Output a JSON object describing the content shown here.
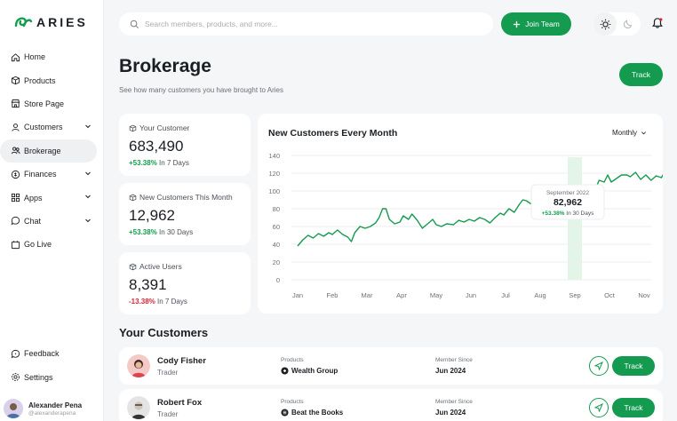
{
  "brand": {
    "name": "ARIES",
    "accent": "#149b50"
  },
  "sidebar": {
    "items": [
      {
        "label": "Home",
        "icon": "home-icon"
      },
      {
        "label": "Products",
        "icon": "box-icon"
      },
      {
        "label": "Store Page",
        "icon": "store-icon"
      },
      {
        "label": "Customers",
        "icon": "user-icon",
        "has_submenu": true
      },
      {
        "label": "Brokerage",
        "icon": "users-icon",
        "active": true
      },
      {
        "label": "Finances",
        "icon": "finance-icon",
        "has_submenu": true
      },
      {
        "label": "Apps",
        "icon": "grid-icon",
        "has_submenu": true
      },
      {
        "label": "Chat",
        "icon": "chat-icon",
        "has_submenu": true
      },
      {
        "label": "Go Live",
        "icon": "calendar-icon"
      }
    ],
    "bottom": [
      {
        "label": "Feedback",
        "icon": "feedback-icon"
      },
      {
        "label": "Settings",
        "icon": "gear-icon"
      }
    ],
    "user": {
      "name": "Alexander Pena",
      "handle": "@alexanderapena"
    }
  },
  "topbar": {
    "search_placeholder": "Search members, products, and more...",
    "join_label": "Join Team"
  },
  "header": {
    "title": "Brokerage",
    "subtitle": "See how many customers you have brought to Aries",
    "track_label": "Track"
  },
  "stats": [
    {
      "label": "Your Customer",
      "value": "683,490",
      "change": "+53.38%",
      "period": "In 7 Days",
      "trend": "up"
    },
    {
      "label": "New Customers This Month",
      "value": "12,962",
      "change": "+53.38%",
      "period": "In 30 Days",
      "trend": "up"
    },
    {
      "label": "Active Users",
      "value": "8,391",
      "change": "-13.38%",
      "period": "In 7 Days",
      "trend": "down"
    }
  ],
  "chart": {
    "title": "New Customers Every Month",
    "period_label": "Monthly",
    "tooltip": {
      "date": "September 2022",
      "value": "82,962",
      "change": "+53.38%",
      "period": "In 30 Days"
    }
  },
  "chart_data": {
    "type": "line",
    "title": "New Customers Every Month",
    "categories": [
      "Jan",
      "Feb",
      "Mar",
      "Apr",
      "May",
      "Jun",
      "Jul",
      "Aug",
      "Sep",
      "Oct",
      "Nov"
    ],
    "y_ticks": [
      0,
      20,
      40,
      60,
      80,
      100,
      120,
      140
    ],
    "ylim": [
      0,
      140
    ],
    "grid": true,
    "highlight_category": "Sep",
    "series": [
      {
        "color": "#149b50",
        "points": [
          [
            0,
            38
          ],
          [
            0.15,
            45
          ],
          [
            0.3,
            50
          ],
          [
            0.45,
            47
          ],
          [
            0.6,
            52
          ],
          [
            0.75,
            49
          ],
          [
            0.9,
            53
          ],
          [
            1.0,
            51
          ],
          [
            1.15,
            56
          ],
          [
            1.3,
            51
          ],
          [
            1.45,
            48
          ],
          [
            1.55,
            43
          ],
          [
            1.65,
            53
          ],
          [
            1.8,
            60
          ],
          [
            1.95,
            58
          ],
          [
            2.1,
            60
          ],
          [
            2.25,
            64
          ],
          [
            2.35,
            70
          ],
          [
            2.45,
            80
          ],
          [
            2.55,
            80
          ],
          [
            2.65,
            68
          ],
          [
            2.8,
            63
          ],
          [
            2.95,
            65
          ],
          [
            3.05,
            72
          ],
          [
            3.2,
            68
          ],
          [
            3.3,
            74
          ],
          [
            3.45,
            67
          ],
          [
            3.6,
            58
          ],
          [
            3.75,
            63
          ],
          [
            3.9,
            68
          ],
          [
            4.0,
            62
          ],
          [
            4.15,
            60
          ],
          [
            4.3,
            63
          ],
          [
            4.5,
            62
          ],
          [
            4.65,
            67
          ],
          [
            4.8,
            65
          ],
          [
            4.95,
            68
          ],
          [
            5.1,
            66
          ],
          [
            5.25,
            70
          ],
          [
            5.4,
            68
          ],
          [
            5.55,
            64
          ],
          [
            5.7,
            70
          ],
          [
            5.85,
            75
          ],
          [
            5.95,
            73
          ],
          [
            6.1,
            80
          ],
          [
            6.25,
            76
          ],
          [
            6.4,
            85
          ],
          [
            6.5,
            90
          ],
          [
            6.6,
            89
          ],
          [
            6.75,
            85
          ],
          [
            6.9,
            88
          ],
          [
            7.05,
            83
          ],
          [
            7.2,
            90
          ],
          [
            7.35,
            86
          ],
          [
            7.5,
            94
          ],
          [
            7.65,
            100
          ],
          [
            7.8,
            103
          ],
          [
            7.95,
            106
          ],
          [
            8.0,
            105
          ],
          [
            8.1,
            100
          ],
          [
            8.25,
            102
          ],
          [
            8.4,
            95
          ],
          [
            8.55,
            98
          ],
          [
            8.7,
            112
          ],
          [
            8.85,
            110
          ],
          [
            8.95,
            118
          ],
          [
            9.05,
            110
          ],
          [
            9.2,
            114
          ],
          [
            9.35,
            118
          ],
          [
            9.5,
            118
          ],
          [
            9.6,
            116
          ],
          [
            9.75,
            121
          ],
          [
            9.9,
            113
          ],
          [
            10.05,
            118
          ],
          [
            10.2,
            112
          ],
          [
            10.35,
            117
          ],
          [
            10.5,
            115
          ],
          [
            10.6,
            122
          ],
          [
            10.8,
            117
          ],
          [
            10.95,
            120
          ],
          [
            11.1,
            118
          ],
          [
            11.2,
            122
          ]
        ]
      }
    ]
  },
  "customers": {
    "title": "Your Customers",
    "products_label": "Products",
    "member_label": "Member Since",
    "track_label": "Track",
    "rows": [
      {
        "name": "Cody Fisher",
        "role": "Trader",
        "product": "Wealth Group",
        "member_since": "Jun 2024"
      },
      {
        "name": "Robert Fox",
        "role": "Trader",
        "product": "Beat the Books",
        "member_since": "Jun 2024"
      }
    ]
  }
}
